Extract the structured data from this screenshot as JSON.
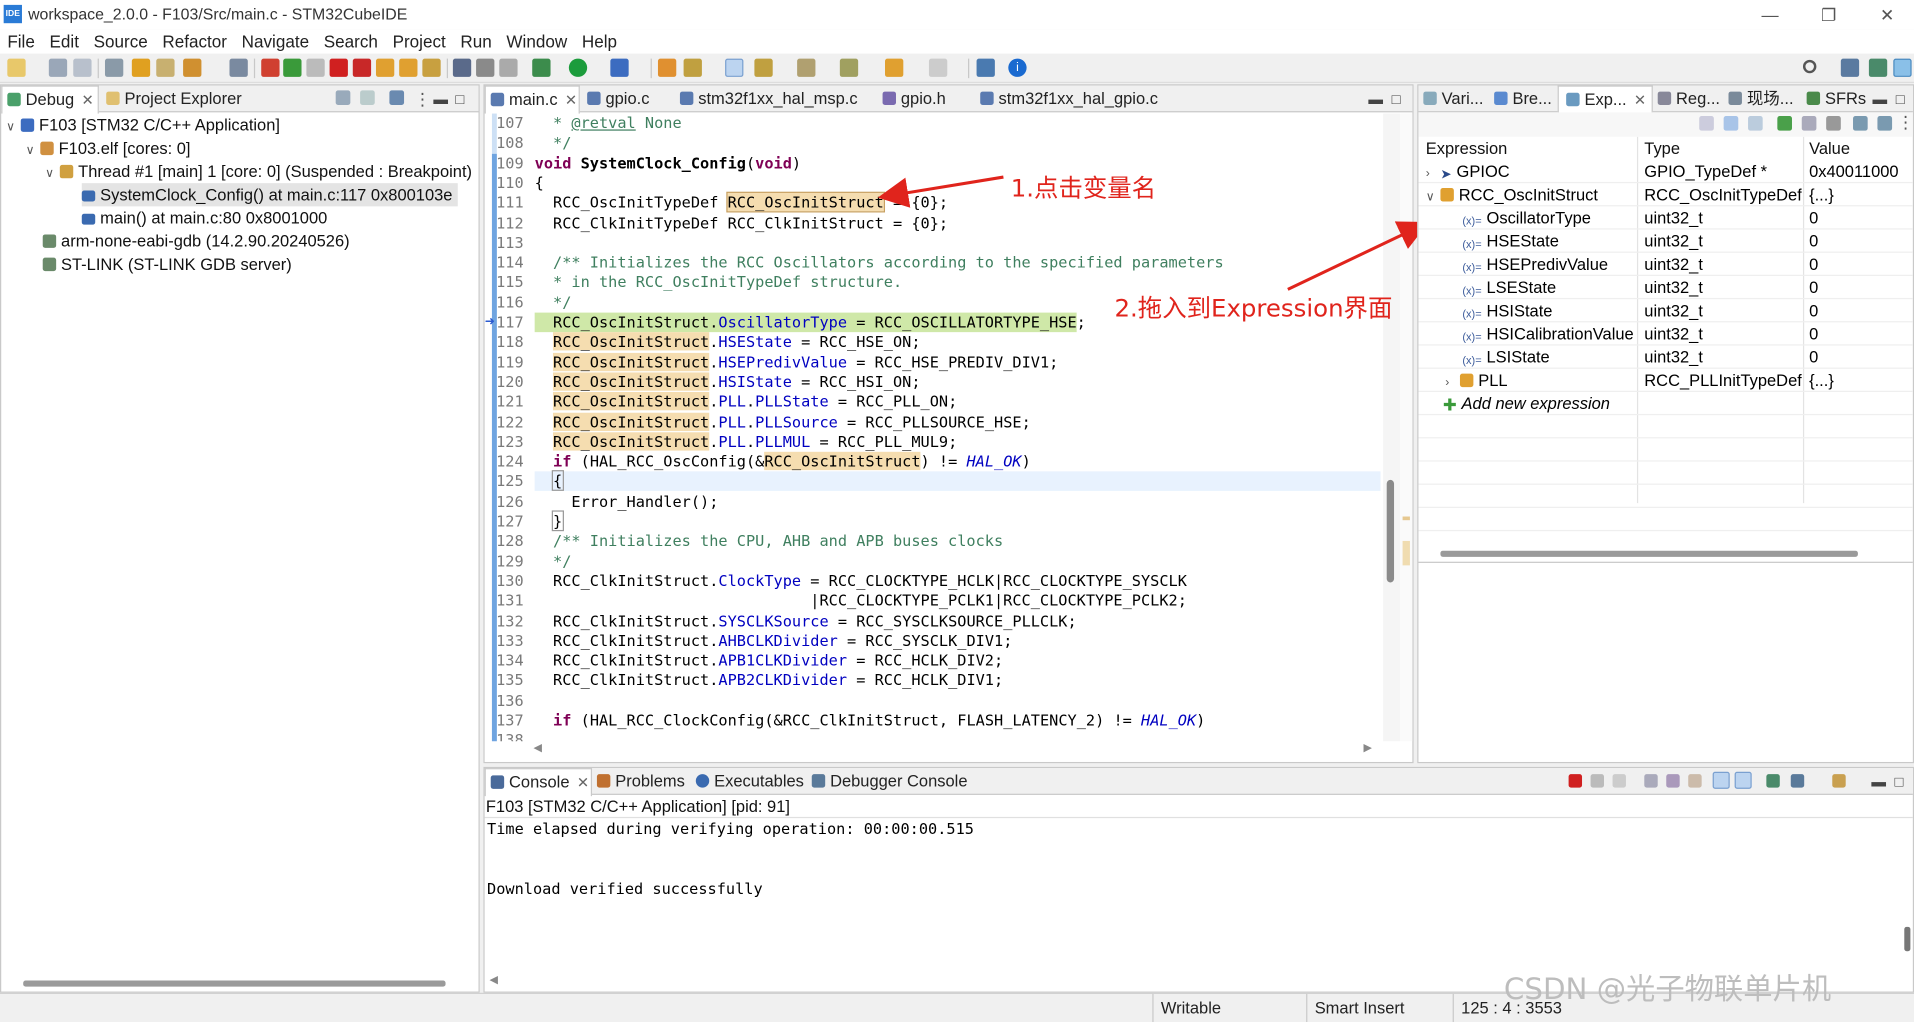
{
  "window": {
    "title": "workspace_2.0.0 - F103/Src/main.c - STM32CubeIDE",
    "logo_text": "IDE"
  },
  "menu": [
    "File",
    "Edit",
    "Source",
    "Refactor",
    "Navigate",
    "Search",
    "Project",
    "Run",
    "Window",
    "Help"
  ],
  "debug_panel": {
    "tabs": [
      "Debug",
      "Project Explorer"
    ],
    "tree": [
      {
        "label": "F103 [STM32 C/C++ Application]"
      },
      {
        "label": "F103.elf [cores: 0]"
      },
      {
        "label": "Thread #1 [main] 1 [core: 0] (Suspended : Breakpoint)"
      },
      {
        "label": "SystemClock_Config() at main.c:117 0x800103e"
      },
      {
        "label": "main() at main.c:80 0x8001000"
      },
      {
        "label": "arm-none-eabi-gdb (14.2.90.20240526)"
      },
      {
        "label": "ST-LINK (ST-LINK GDB server)"
      }
    ]
  },
  "editor": {
    "tabs": [
      "main.c",
      "gpio.c",
      "stm32f1xx_hal_msp.c",
      "gpio.h",
      "stm32f1xx_hal_gpio.c"
    ],
    "lines": [
      {
        "n": "107",
        "text": "  * @retval None"
      },
      {
        "n": "108",
        "text": "  */"
      },
      {
        "n": "109",
        "text": "void SystemClock_Config(void)"
      },
      {
        "n": "110",
        "text": "{"
      },
      {
        "n": "111",
        "text": "  RCC_OscInitTypeDef RCC_OscInitStruct = {0};"
      },
      {
        "n": "112",
        "text": "  RCC_ClkInitTypeDef RCC_ClkInitStruct = {0};"
      },
      {
        "n": "113",
        "text": ""
      },
      {
        "n": "114",
        "text": "  /** Initializes the RCC Oscillators according to the specified parameters"
      },
      {
        "n": "115",
        "text": "  * in the RCC_OscInitTypeDef structure."
      },
      {
        "n": "116",
        "text": "  */"
      },
      {
        "n": "117",
        "text": "  RCC_OscInitStruct.OscillatorType = RCC_OSCILLATORTYPE_HSE;"
      },
      {
        "n": "118",
        "text": "  RCC_OscInitStruct.HSEState = RCC_HSE_ON;"
      },
      {
        "n": "119",
        "text": "  RCC_OscInitStruct.HSEPredivValue = RCC_HSE_PREDIV_DIV1;"
      },
      {
        "n": "120",
        "text": "  RCC_OscInitStruct.HSIState = RCC_HSI_ON;"
      },
      {
        "n": "121",
        "text": "  RCC_OscInitStruct.PLL.PLLState = RCC_PLL_ON;"
      },
      {
        "n": "122",
        "text": "  RCC_OscInitStruct.PLL.PLLSource = RCC_PLLSOURCE_HSE;"
      },
      {
        "n": "123",
        "text": "  RCC_OscInitStruct.PLL.PLLMUL = RCC_PLL_MUL9;"
      },
      {
        "n": "124",
        "text": "  if (HAL_RCC_OscConfig(&RCC_OscInitStruct) != HAL_OK)"
      },
      {
        "n": "125",
        "text": "  {"
      },
      {
        "n": "126",
        "text": "    Error_Handler();"
      },
      {
        "n": "127",
        "text": "  }"
      },
      {
        "n": "128",
        "text": "  /** Initializes the CPU, AHB and APB buses clocks"
      },
      {
        "n": "129",
        "text": "  */"
      },
      {
        "n": "130",
        "text": "  RCC_ClkInitStruct.ClockType = RCC_CLOCKTYPE_HCLK|RCC_CLOCKTYPE_SYSCLK"
      },
      {
        "n": "131",
        "text": "                              |RCC_CLOCKTYPE_PCLK1|RCC_CLOCKTYPE_PCLK2;"
      },
      {
        "n": "132",
        "text": "  RCC_ClkInitStruct.SYSCLKSource = RCC_SYSCLKSOURCE_PLLCLK;"
      },
      {
        "n": "133",
        "text": "  RCC_ClkInitStruct.AHBCLKDivider = RCC_SYSCLK_DIV1;"
      },
      {
        "n": "134",
        "text": "  RCC_ClkInitStruct.APB1CLKDivider = RCC_HCLK_DIV2;"
      },
      {
        "n": "135",
        "text": "  RCC_ClkInitStruct.APB2CLKDivider = RCC_HCLK_DIV1;"
      },
      {
        "n": "136",
        "text": ""
      },
      {
        "n": "137",
        "text": "  if (HAL_RCC_ClockConfig(&RCC_ClkInitStruct, FLASH_LATENCY_2) != HAL_OK)"
      }
    ]
  },
  "annotations": {
    "step1": "1.点击变量名",
    "step2": "2.拖入到Expression界面"
  },
  "right_panel": {
    "tabs": [
      "Vari...",
      "Bre...",
      "Exp...",
      "Reg...",
      "现场...",
      "SFRs"
    ],
    "columns": [
      "Expression",
      "Type",
      "Value"
    ],
    "rows": [
      {
        "name": "GPIOC",
        "type": "GPIO_TypeDef *",
        "value": "0x40011000"
      },
      {
        "name": "RCC_OscInitStruct",
        "type": "RCC_OscInitTypeDef",
        "value": "{...}"
      },
      {
        "name": "OscillatorType",
        "type": "uint32_t",
        "value": "0"
      },
      {
        "name": "HSEState",
        "type": "uint32_t",
        "value": "0"
      },
      {
        "name": "HSEPredivValue",
        "type": "uint32_t",
        "value": "0"
      },
      {
        "name": "LSEState",
        "type": "uint32_t",
        "value": "0"
      },
      {
        "name": "HSIState",
        "type": "uint32_t",
        "value": "0"
      },
      {
        "name": "HSICalibrationValue",
        "type": "uint32_t",
        "value": "0"
      },
      {
        "name": "LSIState",
        "type": "uint32_t",
        "value": "0"
      },
      {
        "name": "PLL",
        "type": "RCC_PLLInitTypeDef",
        "value": "{...}"
      }
    ],
    "add_new": "Add new expression"
  },
  "console": {
    "tabs": [
      "Console",
      "Problems",
      "Executables",
      "Debugger Console"
    ],
    "process": "F103 [STM32 C/C++ Application]  [pid: 91]",
    "lines": [
      "Time elapsed during verifying operation: 00:00:00.515",
      "",
      "",
      "Download verified successfully"
    ]
  },
  "status": {
    "writable": "Writable",
    "insert_mode": "Smart Insert",
    "position": "125 : 4 : 3553"
  },
  "watermark": "CSDN @光子物联单片机",
  "colors": {
    "accent": "#2a7bd6",
    "annotation": "#e0241c",
    "occurrence_highlight": "#f5ddb0",
    "current_line": "#e8f2fe"
  }
}
